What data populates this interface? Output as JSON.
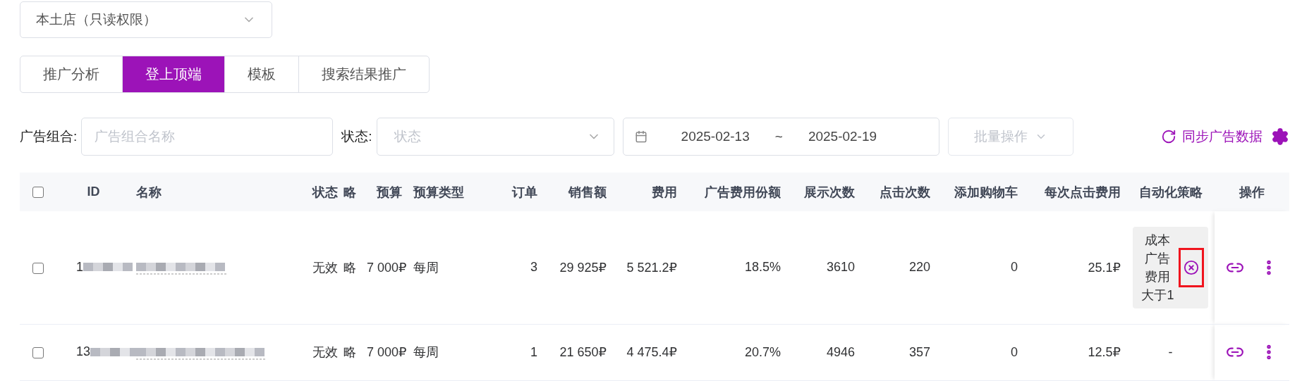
{
  "shop_select": {
    "value": "本土店（只读权限）"
  },
  "tabs": [
    {
      "label": "推广分析",
      "selected": false
    },
    {
      "label": "登上顶端",
      "selected": true
    },
    {
      "label": "模板",
      "selected": false
    },
    {
      "label": "搜索结果推广",
      "selected": false
    }
  ],
  "filters": {
    "group_label": "广告组合:",
    "group_placeholder": "广告组合名称",
    "status_label": "状态:",
    "status_placeholder": "状态",
    "date_start": "2025-02-13",
    "date_separator": "~",
    "date_end": "2025-02-19",
    "batch_button": "批量操作",
    "batch_disabled": true,
    "sync_link": "同步广告数据"
  },
  "table": {
    "columns": [
      "ID",
      "名称",
      "状态",
      "略",
      "预算",
      "预算类型",
      "订单",
      "销售额",
      "费用",
      "广告费用份额",
      "展示次数",
      "点击次数",
      "添加购物车",
      "每次点击费用",
      "自动化策略",
      "操作"
    ],
    "header_checked": false,
    "rows": [
      {
        "checked": false,
        "id": "1",
        "status": "无效",
        "column_5": "略",
        "budget": "7 000₽",
        "budget_type": "每周",
        "orders": "3",
        "sales": "29 925₽",
        "cost": "5 521.2₽",
        "share": "18.5%",
        "impressions": "3610",
        "clicks": "220",
        "cart": "0",
        "cpc": "25.1₽",
        "automation": {
          "kind": "tag",
          "text": "成本广告费用大于1",
          "highlighted": true
        }
      },
      {
        "checked": false,
        "id": "13",
        "status": "无效",
        "column_5": "略",
        "budget": "7 000₽",
        "budget_type": "每周",
        "orders": "1",
        "sales": "21 650₽",
        "cost": "4 475.4₽",
        "share": "20.7%",
        "impressions": "4946",
        "clicks": "357",
        "cart": "0",
        "cpc": "12.5₽",
        "automation": {
          "kind": "text",
          "text": "-"
        }
      }
    ]
  }
}
